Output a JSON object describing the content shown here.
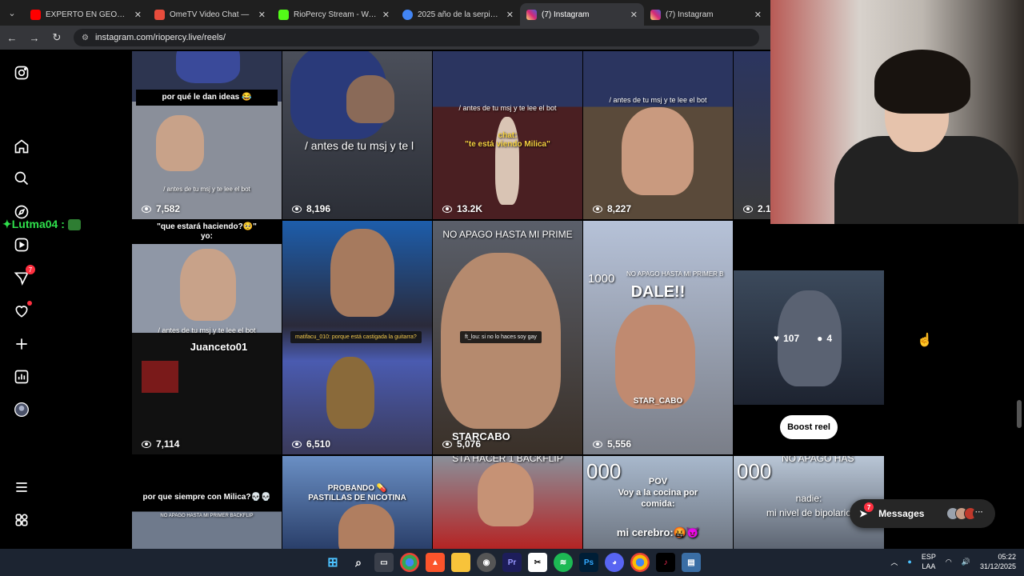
{
  "browser": {
    "tabs": [
      {
        "title": "EXPERTO EN GEOGRAFÍA #",
        "color": "#ff0000",
        "active": false
      },
      {
        "title": "OmeTV Video Chat —",
        "color": "#e74c3c",
        "active": false
      },
      {
        "title": "RioPercy Stream - Watch L",
        "color": "#53fc18",
        "active": false
      },
      {
        "title": "2025 año de la serpiente",
        "color": "#4285f4",
        "active": false
      },
      {
        "title": "(7) Instagram",
        "color": "#d62976",
        "active": true
      },
      {
        "title": "(7) Instagram",
        "color": "#d62976",
        "active": false
      }
    ],
    "url": "instagram.com/riopercy.live/reels/"
  },
  "sidebar": {
    "chat_overlay": "✦Lutma04 : ",
    "notifications_badge": "7"
  },
  "reels": [
    {
      "views": "7,582",
      "captions": [
        "por qué le dan ideas 😂",
        "/ antes de tu msj y te lee el bot"
      ]
    },
    {
      "views": "8,196",
      "captions": [
        "/ antes de tu msj y te l"
      ]
    },
    {
      "views": "13.2K",
      "captions": [
        "/ antes de tu msj y te lee el bot",
        "chat:",
        "\"te está viendo Milica\""
      ]
    },
    {
      "views": "8,227",
      "captions": [
        "/ antes de tu msj y te lee el bot"
      ]
    },
    {
      "views": "2.1K",
      "captions": []
    },
    {
      "views": "7,114",
      "captions": [
        "\"que estará haciendo?🥺\"",
        "yo:",
        "/ antes de tu msj y te lee el bot",
        "Juanceto01"
      ]
    },
    {
      "views": "6,510",
      "captions": [
        "matifacu_010: porque está castigada la guitarra?"
      ]
    },
    {
      "views": "5,076",
      "captions": [
        "NO APAGO HASTA MI PRIME",
        "ft_lou: si no lo haces soy gay",
        "STARCABO"
      ]
    },
    {
      "views": "5,556",
      "captions": [
        "1000",
        "NO APAGO HASTA MI PRIMER B",
        "DALE!!",
        "STAR_CABO"
      ]
    },
    {
      "views": "",
      "captions": []
    },
    {
      "views": "",
      "captions": [
        "por que siempre con Milica?💀💀",
        "NO APAGO HASTA MI PRIMER BACKFLIP"
      ]
    },
    {
      "views": "",
      "captions": [
        "PROBANDO 💊",
        "PASTILLAS DE NICOTINA"
      ]
    },
    {
      "views": "",
      "captions": [
        "STA HACER 1 BACKFLIP"
      ]
    },
    {
      "views": "",
      "captions": [
        "000",
        "POV",
        "Voy a la cocina por",
        "comida:",
        "mi cerebro:🤬😈"
      ]
    },
    {
      "views": "",
      "captions": [
        "000",
        "NO APAGO HAS",
        "nadie:",
        "mi nivel de bipolario"
      ]
    }
  ],
  "hover": {
    "likes": "107",
    "comments": "4",
    "boost_label": "Boost reel"
  },
  "messages": {
    "label": "Messages",
    "badge": "7"
  },
  "taskbar": {
    "lang1": "ESP",
    "lang2": "LAA",
    "time": "05:22",
    "date": "31/12/2025"
  }
}
